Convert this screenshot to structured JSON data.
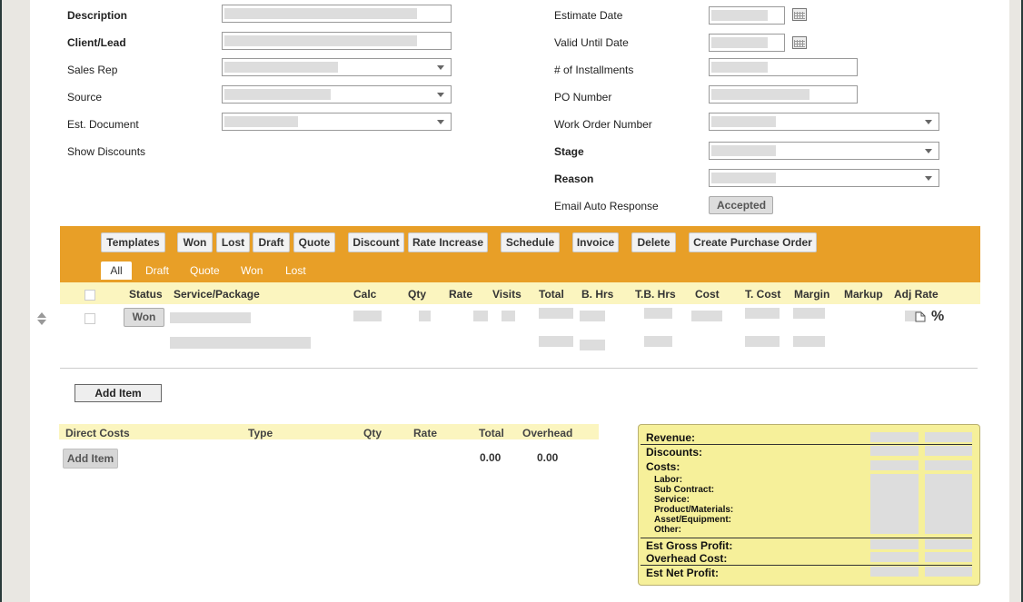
{
  "form_left": {
    "description_label": "Description",
    "client_label": "Client/Lead",
    "sales_rep_label": "Sales Rep",
    "source_label": "Source",
    "est_document_label": "Est. Document",
    "show_discounts_label": "Show Discounts"
  },
  "form_right": {
    "estimate_date_label": "Estimate Date",
    "valid_until_label": "Valid Until Date",
    "installments_label": "# of Installments",
    "po_number_label": "PO Number",
    "work_order_label": "Work Order Number",
    "stage_label": "Stage",
    "reason_label": "Reason",
    "email_auto_label": "Email Auto Response",
    "accepted_label": "Accepted"
  },
  "toolbar": {
    "templates": "Templates",
    "won": "Won",
    "lost": "Lost",
    "draft": "Draft",
    "quote": "Quote",
    "discount": "Discount",
    "rate_increase": "Rate Increase",
    "schedule": "Schedule",
    "invoice": "Invoice",
    "delete": "Delete",
    "create_po": "Create Purchase Order"
  },
  "filters": [
    "All",
    "Draft",
    "Quote",
    "Won",
    "Lost"
  ],
  "table": {
    "headers": [
      "Status",
      "Service/Package",
      "Calc",
      "Qty",
      "Rate",
      "Visits",
      "Total",
      "B. Hrs",
      "T.B. Hrs",
      "Cost",
      "T. Cost",
      "Margin",
      "Markup",
      "Adj Rate"
    ],
    "row_status": "Won",
    "pct_symbol": "%"
  },
  "add_item": "Add Item",
  "direct_costs": {
    "headers": [
      "Direct Costs",
      "Type",
      "Qty",
      "Rate",
      "Total",
      "Overhead"
    ],
    "add_item": "Add Item",
    "total": "0.00",
    "overhead": "0.00"
  },
  "summary": {
    "revenue": "Revenue:",
    "discounts": "Discounts:",
    "costs": "Costs:",
    "labor": "Labor:",
    "sub_contract": "Sub Contract:",
    "service": "Service:",
    "product_materials": "Product/Materials:",
    "asset_equipment": "Asset/Equipment:",
    "other": "Other:",
    "est_gross_profit": "Est Gross Profit:",
    "overhead_cost": "Overhead Cost:",
    "est_net_profit": "Est Net Profit:"
  }
}
